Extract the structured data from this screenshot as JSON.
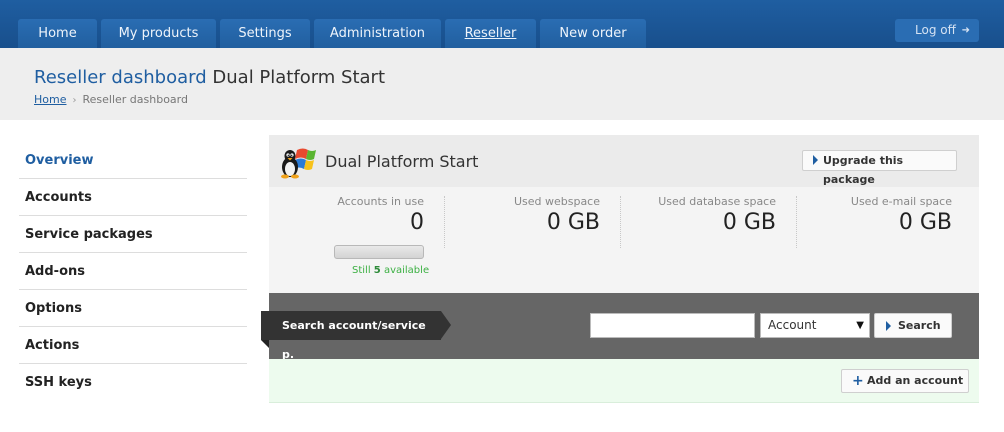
{
  "nav": {
    "tabs": [
      {
        "label": "Home"
      },
      {
        "label": "My products"
      },
      {
        "label": "Settings"
      },
      {
        "label": "Administration"
      },
      {
        "label": "Reseller"
      },
      {
        "label": "New order"
      }
    ],
    "active_tab": "Reseller",
    "logoff_label": "Log off"
  },
  "header": {
    "title_lead": "Reseller dashboard",
    "title_rest": "Dual Platform Start",
    "breadcrumb": {
      "home": "Home",
      "current": "Reseller dashboard"
    }
  },
  "sidebar": {
    "items": [
      {
        "label": "Overview"
      },
      {
        "label": "Accounts"
      },
      {
        "label": "Service packages"
      },
      {
        "label": "Add-ons"
      },
      {
        "label": "Options"
      },
      {
        "label": "Actions"
      },
      {
        "label": "SSH keys"
      }
    ]
  },
  "package": {
    "title": "Dual Platform Start",
    "icon": "linux-windows-icon",
    "upgrade_label": "Upgrade this package",
    "stats": [
      {
        "label": "Accounts in use",
        "value": "0"
      },
      {
        "label": "Used webspace",
        "value": "0 GB"
      },
      {
        "label": "Used database space",
        "value": "0 GB"
      },
      {
        "label": "Used e-mail space",
        "value": "0 GB"
      }
    ],
    "accounts_progress_fraction": 0,
    "still_prefix": "Still",
    "still_count": "5",
    "still_suffix": "available"
  },
  "search": {
    "label": "Search account/service p.",
    "input_value": "",
    "input_placeholder": "",
    "select_value": "Account",
    "button_label": "Search"
  },
  "add_account": {
    "label": "Add an account"
  },
  "colors": {
    "brand_blue": "#1f5ea1",
    "available_green": "#3cb043",
    "search_bar": "#666666",
    "add_bar": "#edfbee"
  }
}
